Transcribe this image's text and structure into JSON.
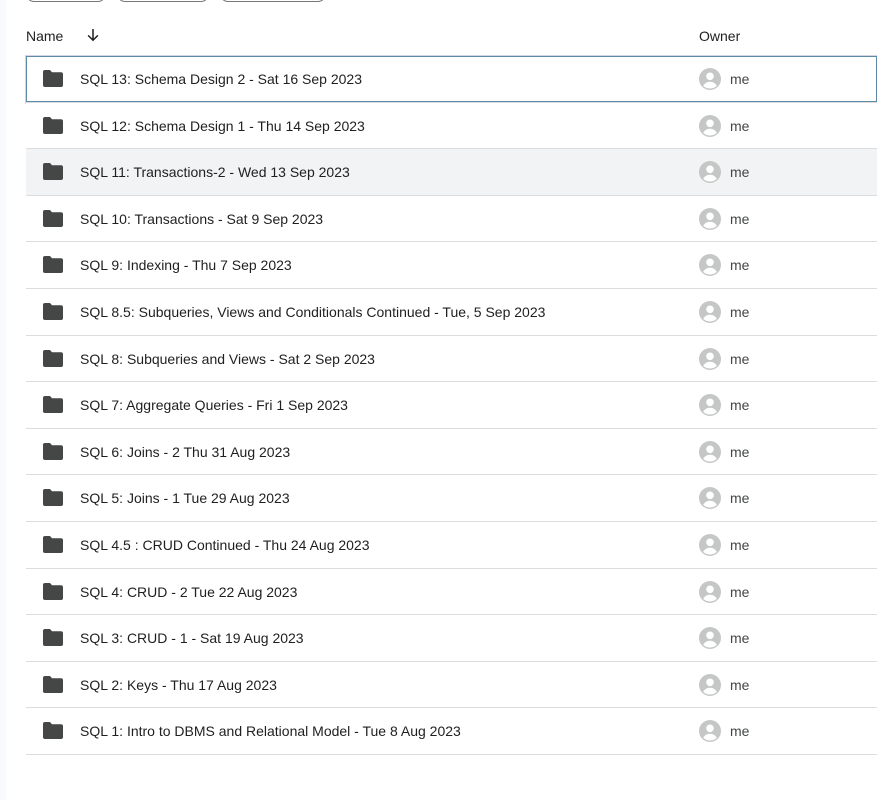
{
  "header": {
    "name_label": "Name",
    "owner_label": "Owner",
    "sort_icon": "arrow-down-icon"
  },
  "files": [
    {
      "name": "SQL 13: Schema Design 2 - Sat 16 Sep 2023",
      "owner": "me"
    },
    {
      "name": "SQL 12: Schema Design 1 - Thu 14 Sep 2023",
      "owner": "me"
    },
    {
      "name": "SQL 11: Transactions-2 - Wed 13 Sep 2023",
      "owner": "me"
    },
    {
      "name": "SQL 10: Transactions - Sat 9 Sep 2023",
      "owner": "me"
    },
    {
      "name": "SQL 9: Indexing - Thu 7 Sep 2023",
      "owner": "me"
    },
    {
      "name": "SQL 8.5: Subqueries, Views and Conditionals Continued - Tue, 5 Sep 2023",
      "owner": "me"
    },
    {
      "name": "SQL 8: Subqueries and Views - Sat 2 Sep 2023",
      "owner": "me"
    },
    {
      "name": "SQL 7: Aggregate Queries - Fri 1 Sep 2023",
      "owner": "me"
    },
    {
      "name": "SQL 6: Joins - 2 Thu 31 Aug 2023",
      "owner": "me"
    },
    {
      "name": "SQL 5: Joins - 1 Tue 29 Aug 2023",
      "owner": "me"
    },
    {
      "name": "SQL 4.5 : CRUD Continued - Thu 24 Aug 2023",
      "owner": "me"
    },
    {
      "name": "SQL 4: CRUD - 2 Tue 22 Aug 2023",
      "owner": "me"
    },
    {
      "name": "SQL 3: CRUD - 1 - Sat 19 Aug 2023",
      "owner": "me"
    },
    {
      "name": "SQL 2: Keys - Thu 17 Aug 2023",
      "owner": "me"
    },
    {
      "name": "SQL 1: Intro to DBMS and Relational Model - Tue 8 Aug 2023",
      "owner": "me"
    }
  ],
  "colors": {
    "folder": "#444746",
    "avatar": "#c4c7c5",
    "selected_border": "#5f8aa6",
    "hover_row": "#f1f3f4"
  }
}
